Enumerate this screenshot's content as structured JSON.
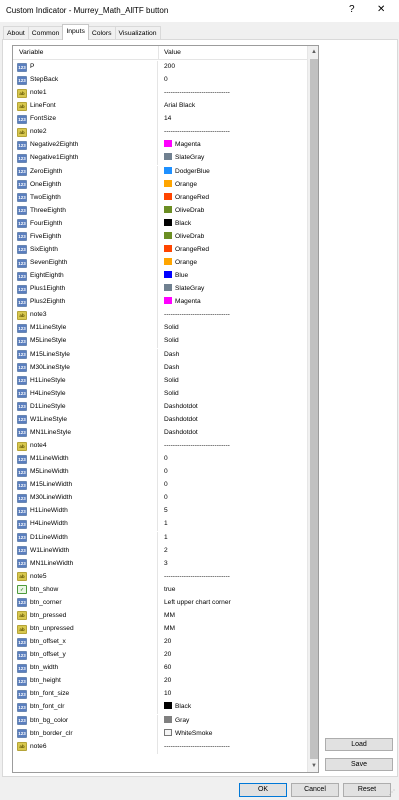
{
  "window": {
    "title": "Custom Indicator - Murrey_Math_AllTF button",
    "help_label": "?",
    "close_label": "✕"
  },
  "tabs": [
    "About",
    "Common",
    "Inputs",
    "Colors",
    "Visualization"
  ],
  "active_tab": "Inputs",
  "grid": {
    "headers": {
      "variable": "Variable",
      "value": "Value"
    },
    "rows": [
      {
        "type": "int",
        "name": "P",
        "value": "200"
      },
      {
        "type": "int",
        "name": "StepBack",
        "value": "0"
      },
      {
        "type": "str",
        "name": "note1",
        "value": "------------------------------"
      },
      {
        "type": "str",
        "name": "LineFont",
        "value": "Arial Black"
      },
      {
        "type": "int",
        "name": "FontSize",
        "value": "14"
      },
      {
        "type": "str",
        "name": "note2",
        "value": "------------------------------"
      },
      {
        "type": "color",
        "name": "Negative2Eighth",
        "value": "Magenta",
        "color": "#ff00ff"
      },
      {
        "type": "color",
        "name": "Negative1Eighth",
        "value": "SlateGray",
        "color": "#708090"
      },
      {
        "type": "color",
        "name": "ZeroEighth",
        "value": "DodgerBlue",
        "color": "#1e90ff"
      },
      {
        "type": "color",
        "name": "OneEighth",
        "value": "Orange",
        "color": "#ffa500"
      },
      {
        "type": "color",
        "name": "TwoEighth",
        "value": "OrangeRed",
        "color": "#ff4500"
      },
      {
        "type": "color",
        "name": "ThreeEighth",
        "value": "OliveDrab",
        "color": "#6b8e23"
      },
      {
        "type": "color",
        "name": "FourEighth",
        "value": "Black",
        "color": "#000000"
      },
      {
        "type": "color",
        "name": "FiveEighth",
        "value": "OliveDrab",
        "color": "#6b8e23"
      },
      {
        "type": "color",
        "name": "SixEighth",
        "value": "OrangeRed",
        "color": "#ff4500"
      },
      {
        "type": "color",
        "name": "SevenEighth",
        "value": "Orange",
        "color": "#ffa500"
      },
      {
        "type": "color",
        "name": "EightEighth",
        "value": "Blue",
        "color": "#0000ff"
      },
      {
        "type": "color",
        "name": "Plus1Eighth",
        "value": "SlateGray",
        "color": "#708090"
      },
      {
        "type": "color",
        "name": "Plus2Eighth",
        "value": "Magenta",
        "color": "#ff00ff"
      },
      {
        "type": "str",
        "name": "note3",
        "value": "------------------------------"
      },
      {
        "type": "int",
        "name": "M1LineStyle",
        "value": "Solid"
      },
      {
        "type": "int",
        "name": "M5LineStyle",
        "value": "Solid"
      },
      {
        "type": "int",
        "name": "M15LineStyle",
        "value": "Dash"
      },
      {
        "type": "int",
        "name": "M30LineStyle",
        "value": "Dash"
      },
      {
        "type": "int",
        "name": "H1LineStyle",
        "value": "Solid"
      },
      {
        "type": "int",
        "name": "H4LineStyle",
        "value": "Solid"
      },
      {
        "type": "int",
        "name": "D1LineStyle",
        "value": "Dashdotdot"
      },
      {
        "type": "int",
        "name": "W1LineStyle",
        "value": "Dashdotdot"
      },
      {
        "type": "int",
        "name": "MN1LineStyle",
        "value": "Dashdotdot"
      },
      {
        "type": "str",
        "name": "note4",
        "value": "------------------------------"
      },
      {
        "type": "int",
        "name": "M1LineWidth",
        "value": "0"
      },
      {
        "type": "int",
        "name": "M5LineWidth",
        "value": "0"
      },
      {
        "type": "int",
        "name": "M15LineWidth",
        "value": "0"
      },
      {
        "type": "int",
        "name": "M30LineWidth",
        "value": "0"
      },
      {
        "type": "int",
        "name": "H1LineWidth",
        "value": "5"
      },
      {
        "type": "int",
        "name": "H4LineWidth",
        "value": "1"
      },
      {
        "type": "int",
        "name": "D1LineWidth",
        "value": "1"
      },
      {
        "type": "int",
        "name": "W1LineWidth",
        "value": "2"
      },
      {
        "type": "int",
        "name": "MN1LineWidth",
        "value": "3"
      },
      {
        "type": "str",
        "name": "note5",
        "value": "------------------------------"
      },
      {
        "type": "bool",
        "name": "btn_show",
        "value": "true"
      },
      {
        "type": "int",
        "name": "btn_corner",
        "value": "Left upper chart corner"
      },
      {
        "type": "str",
        "name": "btn_pressed",
        "value": "MM"
      },
      {
        "type": "str",
        "name": "btn_unpressed",
        "value": "MM"
      },
      {
        "type": "int",
        "name": "btn_offset_x",
        "value": "20"
      },
      {
        "type": "int",
        "name": "btn_offset_y",
        "value": "20"
      },
      {
        "type": "int",
        "name": "btn_width",
        "value": "60"
      },
      {
        "type": "int",
        "name": "btn_height",
        "value": "20"
      },
      {
        "type": "int",
        "name": "btn_font_size",
        "value": "10"
      },
      {
        "type": "color",
        "name": "btn_font_clr",
        "value": "Black",
        "color": "#000000"
      },
      {
        "type": "color",
        "name": "btn_bg_color",
        "value": "Gray",
        "color": "#808080"
      },
      {
        "type": "color",
        "name": "btn_border_clr",
        "value": "WhiteSmoke",
        "color": "#f5f5f5"
      },
      {
        "type": "str",
        "name": "note6",
        "value": "------------------------------"
      }
    ]
  },
  "side_buttons": {
    "load": "Load",
    "save": "Save"
  },
  "dialog_buttons": {
    "ok": "OK",
    "cancel": "Cancel",
    "reset": "Reset"
  },
  "icon_text": {
    "int": "123",
    "str": "ab",
    "color": "123",
    "bool": "✓"
  }
}
